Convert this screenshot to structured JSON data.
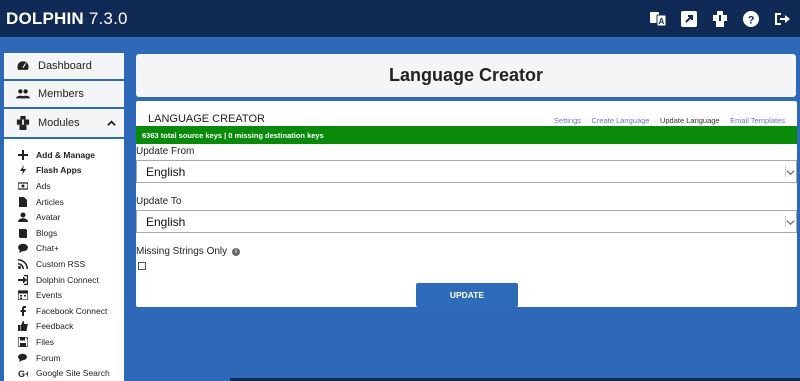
{
  "app": {
    "name": "DOLPHIN",
    "version": "7.3.0"
  },
  "topbar": {
    "icons": [
      "language-icon",
      "external-link-icon",
      "extensions-icon",
      "help-icon",
      "logout-icon"
    ]
  },
  "sidebar": {
    "dashboard_label": "Dashboard",
    "members_label": "Members",
    "modules_label": "Modules",
    "items": [
      {
        "label": "Add & Manage",
        "bold": true,
        "icon": "plus-icon"
      },
      {
        "label": "Flash Apps",
        "bold": true,
        "icon": "bolt-icon"
      },
      {
        "label": "Ads",
        "bold": false,
        "icon": "money-icon"
      },
      {
        "label": "Articles",
        "bold": false,
        "icon": "file-icon"
      },
      {
        "label": "Avatar",
        "bold": false,
        "icon": "user-icon"
      },
      {
        "label": "Blogs",
        "bold": false,
        "icon": "book-icon"
      },
      {
        "label": "Chat+",
        "bold": false,
        "icon": "comment-icon"
      },
      {
        "label": "Custom RSS",
        "bold": false,
        "icon": "rss-icon"
      },
      {
        "label": "Dolphin Connect",
        "bold": false,
        "icon": "sign-in-icon"
      },
      {
        "label": "Events",
        "bold": false,
        "icon": "calendar-icon"
      },
      {
        "label": "Facebook Connect",
        "bold": false,
        "icon": "facebook-icon"
      },
      {
        "label": "Feedback",
        "bold": false,
        "icon": "thumbs-up-icon"
      },
      {
        "label": "Files",
        "bold": false,
        "icon": "save-icon"
      },
      {
        "label": "Forum",
        "bold": false,
        "icon": "comments-icon"
      },
      {
        "label": "Google Site Search",
        "bold": false,
        "icon": "google-plus-icon"
      }
    ]
  },
  "page": {
    "title": "Language Creator"
  },
  "panel": {
    "heading": "LANGUAGE CREATOR",
    "links": [
      {
        "label": "Settings",
        "current": false
      },
      {
        "label": "Create Language",
        "current": false
      },
      {
        "label": "Update Language",
        "current": true
      },
      {
        "label": "Email Templates",
        "current": false
      }
    ],
    "status": "6363 total source keys | 0 missing destination keys",
    "update_from_label": "Update From",
    "update_from_value": "English",
    "update_to_label": "Update To",
    "update_to_value": "English",
    "missing_only_label": "Missing Strings Only",
    "missing_only_checked": false,
    "update_button": "UPDATE"
  },
  "colors": {
    "topbar": "#0f2a55",
    "background": "#2e69b8",
    "status_bar": "#0a8a0a",
    "button": "#2e6cba",
    "link": "#6f74c9"
  }
}
